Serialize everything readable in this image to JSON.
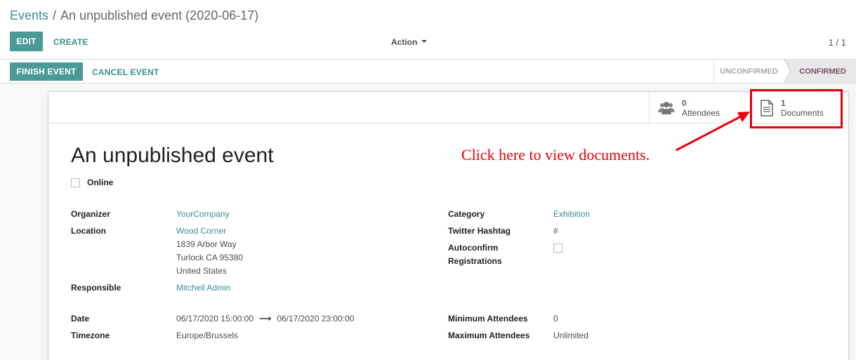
{
  "breadcrumb": {
    "root": "Events",
    "separator": "/",
    "current": "An unpublished event (2020-06-17)"
  },
  "toolbar": {
    "edit_label": "EDIT",
    "create_label": "CREATE",
    "action_label": "Action",
    "pager": "1 / 1"
  },
  "statusbar": {
    "finish_label": "FINISH EVENT",
    "cancel_label": "CANCEL EVENT",
    "stages": [
      "UNCONFIRMED",
      "CONFIRMED"
    ],
    "active_stage": "CONFIRMED"
  },
  "smart_buttons": {
    "attendees": {
      "count": "0",
      "label": "Attendees",
      "icon": "users-icon"
    },
    "documents": {
      "count": "1",
      "label": "Documents",
      "icon": "document-icon"
    }
  },
  "annotation": {
    "text": "Click here to view documents.",
    "color": "#e8000b"
  },
  "event": {
    "name": "An unpublished event",
    "online_label": "Online",
    "online": false
  },
  "fields_left": {
    "organizer_label": "Organizer",
    "organizer": "YourCompany",
    "location_label": "Location",
    "location_name": "Wood Corner",
    "address_line1": "1839 Arbor Way",
    "address_line2": "Turlock CA 95380",
    "address_line3": "United States",
    "responsible_label": "Responsible",
    "responsible": "Mitchell Admin",
    "date_label": "Date",
    "date_start": "06/17/2020 15:00:00",
    "date_end": "06/17/2020 23:00:00",
    "timezone_label": "Timezone",
    "timezone": "Europe/Brussels"
  },
  "fields_right": {
    "category_label": "Category",
    "category": "Exhibition",
    "twitter_label": "Twitter Hashtag",
    "twitter": "#",
    "autoconfirm_label_1": "Autoconfirm",
    "autoconfirm_label_2": "Registrations",
    "autoconfirm": false,
    "min_label": "Minimum Attendees",
    "min": "0",
    "max_label": "Maximum Attendees",
    "max": "Unlimited"
  },
  "colors": {
    "primary": "#4a9b98",
    "link": "#3d8e8c",
    "accent": "#7c4f6b"
  }
}
